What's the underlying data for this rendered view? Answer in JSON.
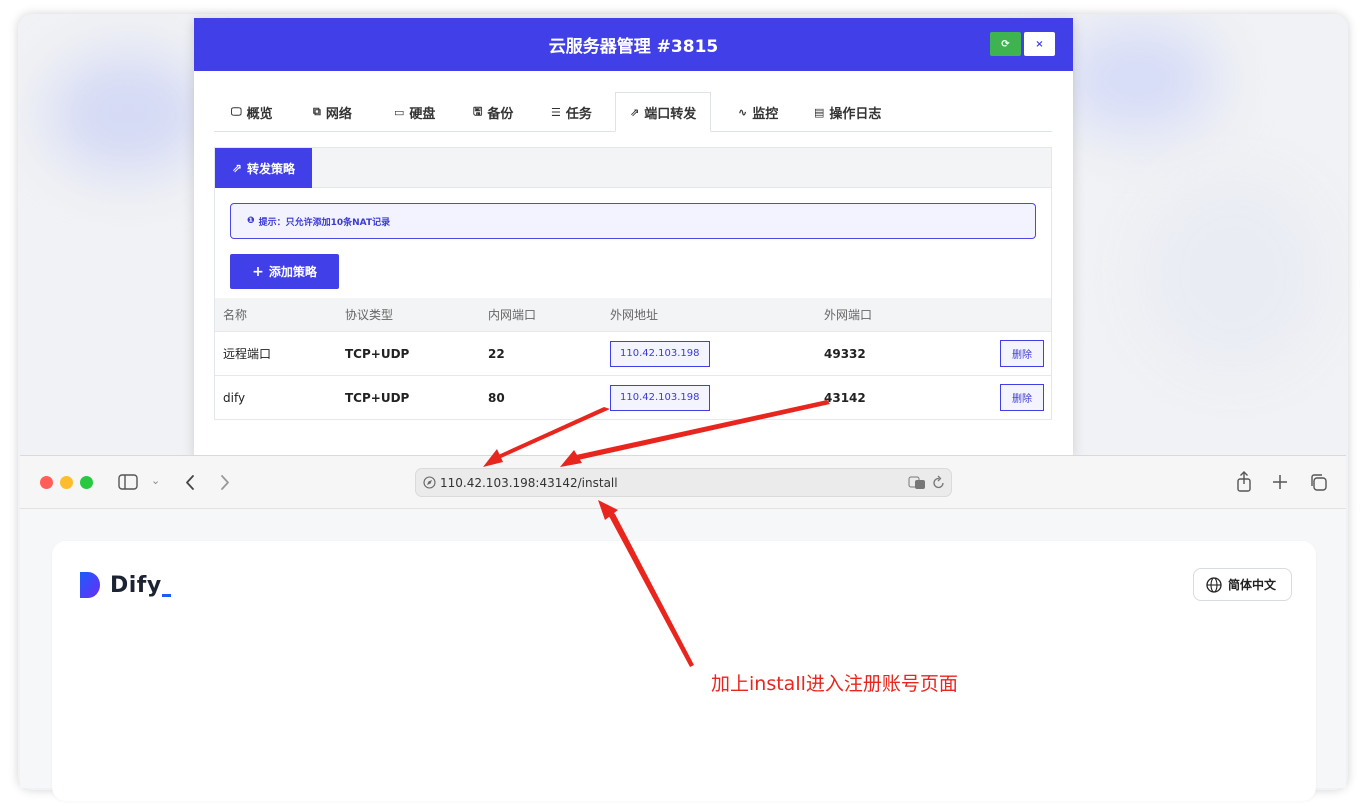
{
  "modal": {
    "title": "云服务器管理 #3815",
    "refresh_label": "⟳",
    "close_label": "×",
    "tabs": [
      {
        "icon": "🖵",
        "label": "概览"
      },
      {
        "icon": "⧉",
        "label": "网络"
      },
      {
        "icon": "▭",
        "label": "硬盘"
      },
      {
        "icon": "🖫",
        "label": "备份"
      },
      {
        "icon": "☰",
        "label": "任务"
      },
      {
        "icon": "⇗",
        "label": "端口转发"
      },
      {
        "icon": "∿",
        "label": "监控"
      },
      {
        "icon": "▤",
        "label": "操作日志"
      }
    ],
    "active_tab": "端口转发",
    "panel_tab_icon": "⇗",
    "panel_tab_label": "转发策略",
    "notice_icon": "❶",
    "notice": "提示：只允许添加10条NAT记录",
    "add_icon": "+",
    "add_label": "添加策略",
    "table": {
      "headers": [
        "名称",
        "协议类型",
        "内网端口",
        "外网地址",
        "外网端口"
      ],
      "rows": [
        {
          "name": "远程端口",
          "protocol": "TCP+UDP",
          "internal_port": "22",
          "external_ip": "110.42.103.198",
          "external_port": "49332",
          "action": "删除"
        },
        {
          "name": "dify",
          "protocol": "TCP+UDP",
          "internal_port": "80",
          "external_ip": "110.42.103.198",
          "external_port": "43142",
          "action": "删除"
        }
      ]
    }
  },
  "browser": {
    "url": "110.42.103.198:43142/install",
    "page": {
      "logo_text": "Dify",
      "language_label": "简体中文"
    }
  },
  "annotation": "加上install进入注册账号页面",
  "colors": {
    "primary": "#4140e8",
    "refresh": "#3fb34f",
    "annotation": "#e8261e"
  }
}
